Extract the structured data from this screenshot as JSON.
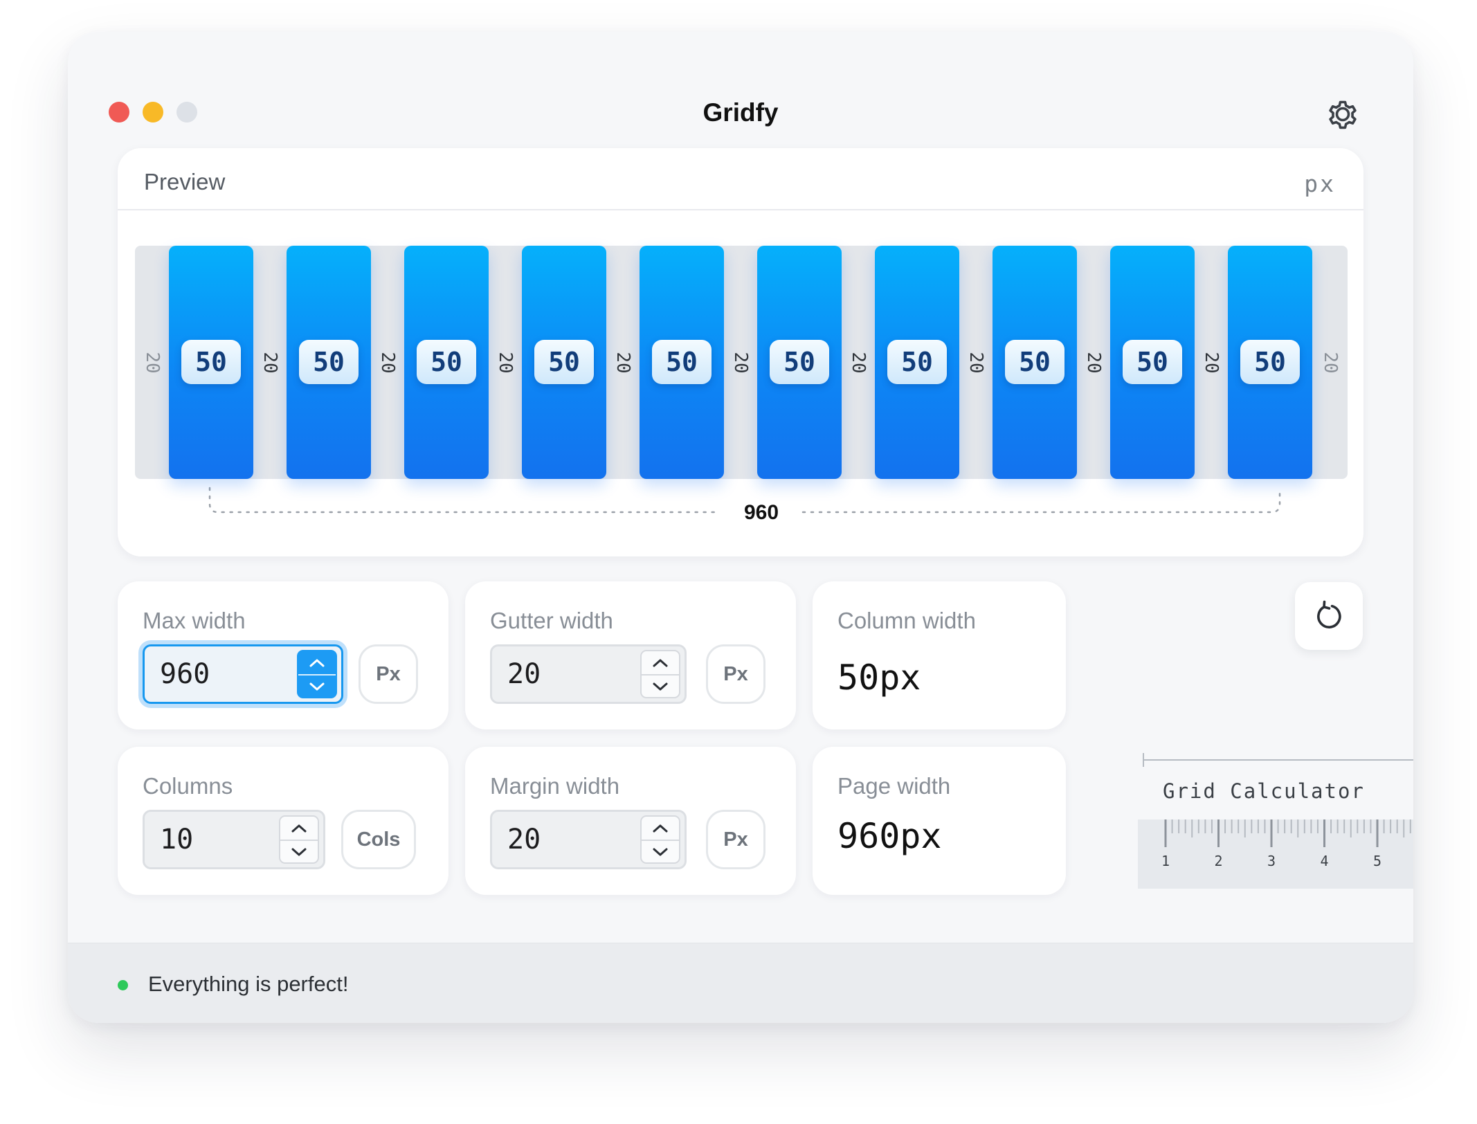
{
  "app": {
    "title": "Gridfy"
  },
  "colors": {
    "accent": "#1d9bf4",
    "column": "#0d86f5",
    "status_ok": "#2ec95a"
  },
  "icons": {
    "settings": "gear-icon",
    "reset": "reset-icon",
    "step_up": "chevron-up-icon",
    "step_down": "chevron-down-icon"
  },
  "preview": {
    "title": "Preview",
    "unit": "px",
    "columns": [
      "50",
      "50",
      "50",
      "50",
      "50",
      "50",
      "50",
      "50",
      "50",
      "50"
    ],
    "gutters": [
      "20",
      "20",
      "20",
      "20",
      "20",
      "20",
      "20",
      "20",
      "20"
    ],
    "margin_left": "20",
    "margin_right": "20",
    "total": "960"
  },
  "max_width": {
    "label": "Max width",
    "value": "960",
    "unit": "Px"
  },
  "gutter_width": {
    "label": "Gutter width",
    "value": "20",
    "unit": "Px"
  },
  "column_width": {
    "label": "Column width",
    "value": "50px"
  },
  "columns": {
    "label": "Columns",
    "value": "10",
    "unit": "Cols"
  },
  "margin_width": {
    "label": "Margin width",
    "value": "20",
    "unit": "Px"
  },
  "page_width": {
    "label": "Page width",
    "value": "960px"
  },
  "ruler": {
    "caption": "Grid Calculator",
    "numbers": [
      "1",
      "2",
      "3",
      "4",
      "5"
    ]
  },
  "status": {
    "text": "Everything is perfect!"
  }
}
